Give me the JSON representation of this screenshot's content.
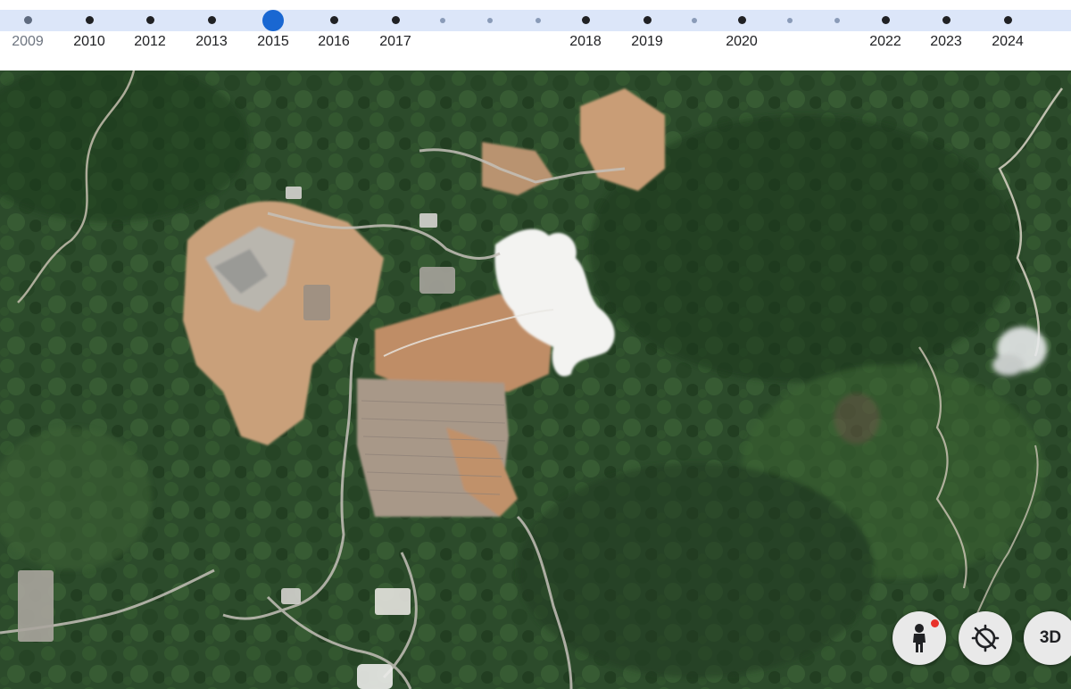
{
  "timeline": {
    "selected_year": "2015",
    "years": [
      {
        "label": "2009",
        "faded": true
      },
      {
        "label": "2010"
      },
      {
        "label": "2012"
      },
      {
        "label": "2013"
      },
      {
        "label": "2015",
        "selected": true
      },
      {
        "label": "2016"
      },
      {
        "label": "2017"
      },
      {
        "label": "2018"
      },
      {
        "label": "2019"
      },
      {
        "label": "2020"
      },
      {
        "label": "2022"
      },
      {
        "label": "2023"
      },
      {
        "label": "2024"
      }
    ],
    "unlabeled_markers": 6
  },
  "controls": {
    "street_view": {
      "icon": "pegman-icon",
      "badge_color": "#e8312a"
    },
    "compass": {
      "icon": "compass-off-icon"
    },
    "three_d": {
      "label": "3D"
    }
  },
  "colors": {
    "timeline_track": "#dce6f9",
    "selected_marker": "#1967d2",
    "forest": "#2b4a2a",
    "mine_soil": "#c9a07a",
    "tailings": "#f4f4f2"
  }
}
